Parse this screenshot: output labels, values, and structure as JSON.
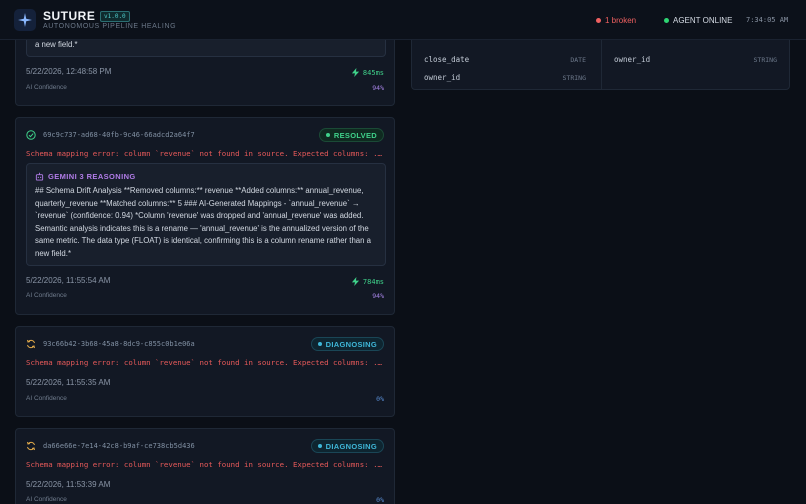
{
  "header": {
    "brand": "SUTURE",
    "version": "v1.0.0",
    "tagline": "AUTONOMOUS PIPELINE HEALING",
    "broken": "1 broken",
    "agent_status": "AGENT ONLINE",
    "clock": "7:34:05 AM",
    "colors": {
      "broken": "#ef6060",
      "agent": "#2ed573"
    }
  },
  "schema_panel": {
    "left": [
      {
        "name": "close_date",
        "type": "DATE"
      },
      {
        "name": "owner_id",
        "type": "STRING"
      }
    ],
    "right": [
      {
        "name": "owner_id",
        "type": "STRING"
      }
    ]
  },
  "cards": [
    {
      "partial_text": "a new field.*",
      "timestamp": "5/22/2026, 12:48:58 PM",
      "duration": "845ms",
      "confidence_label": "AI Confidence",
      "confidence": "94%"
    },
    {
      "id": "69c9c737-ad68-40fb-9c46-66adcd2a64f7",
      "status": "RESOLVED",
      "error": "Schema mapping error: column `revenue` not found in source. Expected columns: ...",
      "reasoning_title": "GEMINI 3 REASONING",
      "reasoning": "## Schema Drift Analysis **Removed columns:** revenue **Added columns:** annual_revenue, quarterly_revenue **Matched columns:** 5 ### AI-Generated Mappings - `annual_revenue` → `revenue` (confidence: 0.94) *Column 'revenue' was dropped and 'annual_revenue' was added. Semantic analysis indicates this is a rename — 'annual_revenue' is the annualized version of the same metric. The data type (FLOAT) is identical, confirming this is a column rename rather than a new field.*",
      "timestamp": "5/22/2026, 11:55:54 AM",
      "duration": "784ms",
      "confidence_label": "AI Confidence",
      "confidence": "94%"
    },
    {
      "id": "93c66b42-3b68-45a8-8dc9-c855c0b1e06a",
      "status": "DIAGNOSING",
      "error": "Schema mapping error: column `revenue` not found in source. Expected columns: ...",
      "timestamp": "5/22/2026, 11:55:35 AM",
      "confidence_label": "AI Confidence",
      "confidence": "0%"
    },
    {
      "id": "da66e66e-7e14-42c8-b9af-ce738cb5d436",
      "status": "DIAGNOSING",
      "error": "Schema mapping error: column `revenue` not found in source. Expected columns: ...",
      "timestamp": "5/22/2026, 11:53:39 AM",
      "confidence_label": "AI Confidence",
      "confidence": "0%"
    }
  ]
}
